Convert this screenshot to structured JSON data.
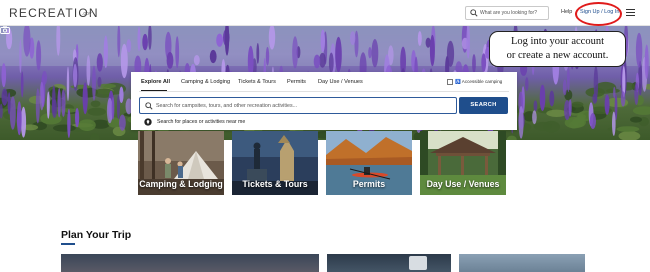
{
  "header": {
    "logo_text": "RECREATION",
    "logo_suffix": ".gov",
    "search_placeholder": "What are you looking for?",
    "help_label": "Help",
    "signup_label": "Sign Up / Log In",
    "highlight_color": "#e01b1b"
  },
  "callout": {
    "line1": "Log into your account",
    "line2": "or create a new account."
  },
  "search_panel": {
    "tabs": [
      "Explore All",
      "Camping & Lodging",
      "Tickets & Tours",
      "Permits",
      "Day Use / Venues"
    ],
    "active_tab": "Explore All",
    "accessible_label": "Accessible camping",
    "search_placeholder": "Search for campsites, tours, and other recreation activities...",
    "search_button": "SEARCH",
    "near_me_label": "Search for places or activities near me"
  },
  "categories": [
    {
      "label": "Camping & Lodging"
    },
    {
      "label": "Tickets & Tours"
    },
    {
      "label": "Permits"
    },
    {
      "label": "Day Use / Venues"
    }
  ],
  "plan": {
    "title": "Plan Your Trip"
  },
  "colors": {
    "accent": "#1f4e8c"
  }
}
